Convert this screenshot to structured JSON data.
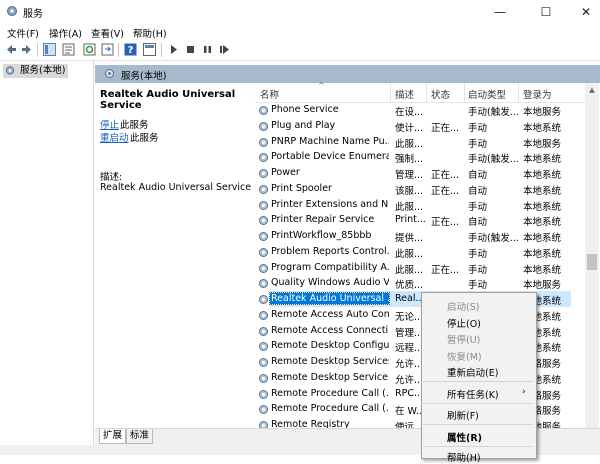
{
  "window": {
    "title": "服务",
    "minimize": "—",
    "maximize": "☐",
    "close": "✕"
  },
  "menu": [
    "文件(F)",
    "操作(A)",
    "查看(V)",
    "帮助(H)"
  ],
  "toolbar_icons": [
    "back-icon",
    "forward-icon",
    "console-tree-icon",
    "properties-icon",
    "refresh-icon",
    "export-icon",
    "help-icon",
    "show-hide-icon",
    "start-icon",
    "stop-icon",
    "pause-icon",
    "restart-icon"
  ],
  "tree": {
    "item": "服务(本地)"
  },
  "pane": {
    "header": "服务(本地)"
  },
  "details": {
    "title": "Realtek Audio Universal Service",
    "stop_link": "停止",
    "stop_suffix": "此服务",
    "restart_link": "重启动",
    "restart_suffix": "此服务",
    "desc_label": "描述:",
    "desc_text": "Realtek Audio Universal Service"
  },
  "columns": {
    "name": "名称",
    "desc": "描述",
    "status": "状态",
    "startup": "启动类型",
    "logon": "登录为"
  },
  "rows": [
    {
      "name": "Phone Service",
      "desc": "在设...",
      "status": "",
      "startup": "手动(触发...",
      "logon": "本地服务"
    },
    {
      "name": "Plug and Play",
      "desc": "使计...",
      "status": "正在...",
      "startup": "手动",
      "logon": "本地系统"
    },
    {
      "name": "PNRP Machine Name Pu...",
      "desc": "此服...",
      "status": "",
      "startup": "手动",
      "logon": "本地服务"
    },
    {
      "name": "Portable Device Enumera...",
      "desc": "强制...",
      "status": "",
      "startup": "手动(触发...",
      "logon": "本地系统"
    },
    {
      "name": "Power",
      "desc": "管理...",
      "status": "正在...",
      "startup": "自动",
      "logon": "本地系统"
    },
    {
      "name": "Print Spooler",
      "desc": "该服...",
      "status": "正在...",
      "startup": "自动",
      "logon": "本地系统"
    },
    {
      "name": "Printer Extensions and N...",
      "desc": "此服...",
      "status": "",
      "startup": "手动",
      "logon": "本地系统"
    },
    {
      "name": "Printer Repair Service",
      "desc": "Print...",
      "status": "正在...",
      "startup": "自动",
      "logon": "本地系统"
    },
    {
      "name": "PrintWorkflow_85bbb",
      "desc": "提供...",
      "status": "",
      "startup": "手动(触发...",
      "logon": "本地系统"
    },
    {
      "name": "Problem Reports Control...",
      "desc": "此服...",
      "status": "",
      "startup": "手动",
      "logon": "本地系统"
    },
    {
      "name": "Program Compatibility A...",
      "desc": "此服...",
      "status": "正在...",
      "startup": "手动",
      "logon": "本地系统"
    },
    {
      "name": "Quality Windows Audio V...",
      "desc": "优质...",
      "status": "",
      "startup": "手动",
      "logon": "本地服务"
    },
    {
      "name": "Realtek Audio Universal ...",
      "desc": "Real...",
      "status": "",
      "startup": "",
      "logon": "本地系统"
    },
    {
      "name": "Remote Access Auto Con...",
      "desc": "无论...",
      "status": "",
      "startup": "",
      "logon": "本地系统"
    },
    {
      "name": "Remote Access Connecti...",
      "desc": "管理...",
      "status": "",
      "startup": "",
      "logon": "本地系统"
    },
    {
      "name": "Remote Desktop Configu...",
      "desc": "远程...",
      "status": "",
      "startup": "",
      "logon": "本地系统"
    },
    {
      "name": "Remote Desktop Services",
      "desc": "允许...",
      "status": "",
      "startup": "",
      "logon": "网络服务"
    },
    {
      "name": "Remote Desktop Service...",
      "desc": "允许...",
      "status": "",
      "startup": "",
      "logon": "本地系统"
    },
    {
      "name": "Remote Procedure Call (...",
      "desc": "RPC...",
      "status": "",
      "startup": "",
      "logon": "网络服务"
    },
    {
      "name": "Remote Procedure Call (...",
      "desc": "在 W...",
      "status": "",
      "startup": "",
      "logon": "网络服务"
    },
    {
      "name": "Remote Registry",
      "desc": "使远...",
      "status": "",
      "startup": "",
      "logon": "本地服务"
    }
  ],
  "context_menu": {
    "start": "启动(S)",
    "stop": "停止(O)",
    "pause": "暂停(U)",
    "resume": "恢复(M)",
    "restart": "重新启动(E)",
    "all_tasks": "所有任务(K)",
    "refresh": "刷新(F)",
    "properties": "属性(R)",
    "help": "帮助(H)"
  },
  "tabs": [
    "扩展",
    "标准"
  ]
}
